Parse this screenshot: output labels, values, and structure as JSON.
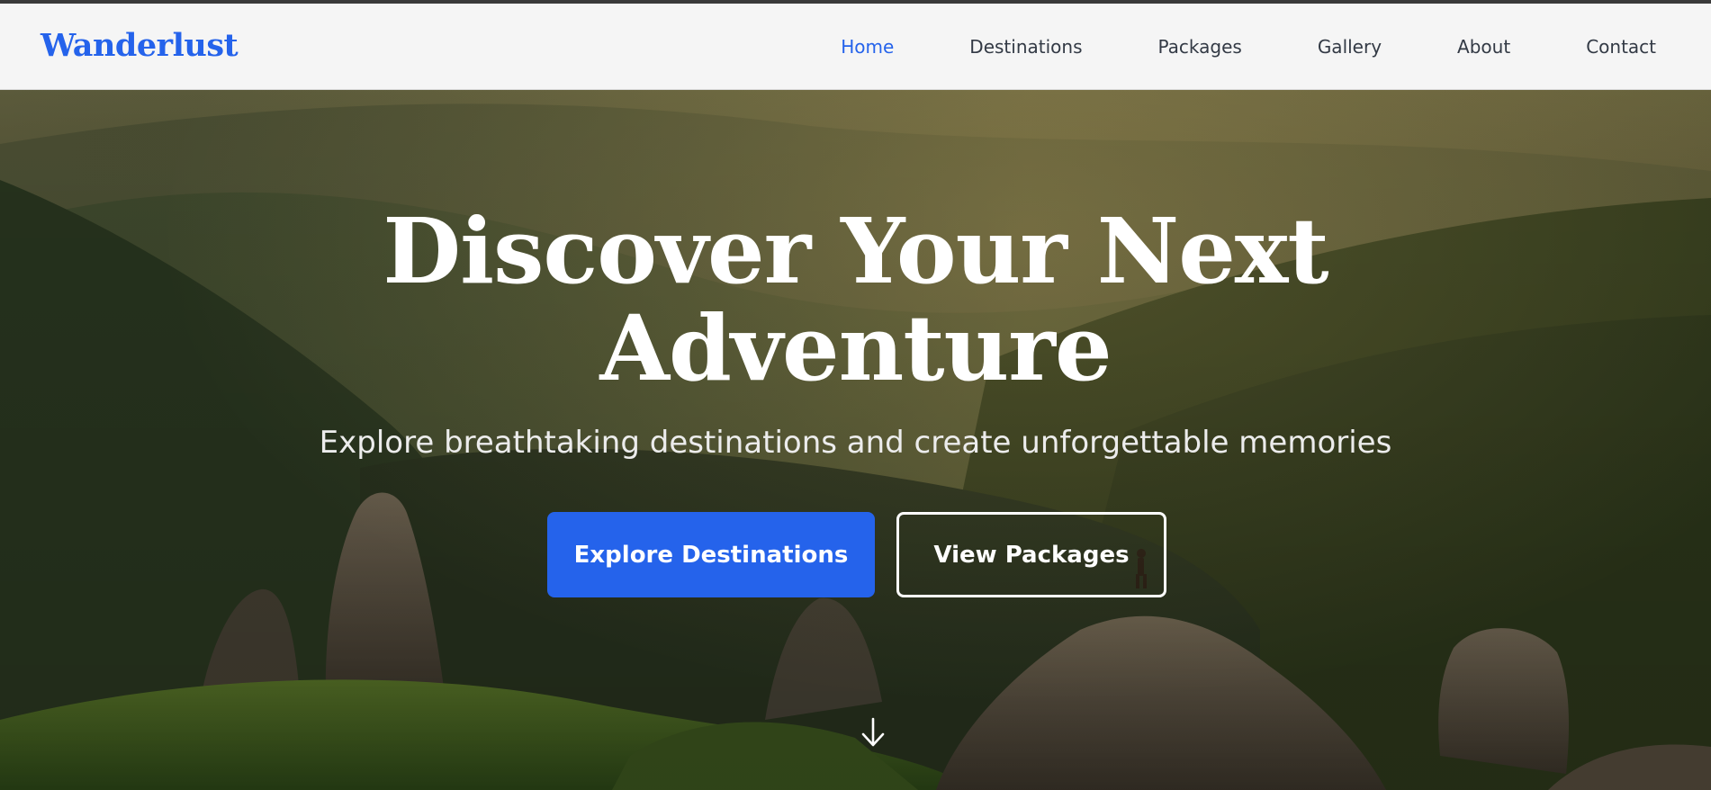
{
  "brand": {
    "name": "Wanderlust",
    "accent": "#2563eb"
  },
  "nav": {
    "items": [
      {
        "label": "Home",
        "active": true
      },
      {
        "label": "Destinations",
        "active": false
      },
      {
        "label": "Packages",
        "active": false
      },
      {
        "label": "Gallery",
        "active": false
      },
      {
        "label": "About",
        "active": false
      },
      {
        "label": "Contact",
        "active": false
      }
    ]
  },
  "hero": {
    "title_line1": "Discover Your Next",
    "title_line2": "Adventure",
    "subtitle": "Explore breathtaking destinations and create unforgettable memories",
    "primary_cta": "Explore Destinations",
    "secondary_cta": "View Packages",
    "scroll_icon": "arrow-down-icon",
    "background": "mountain-forest-landscape-with-hiker"
  }
}
